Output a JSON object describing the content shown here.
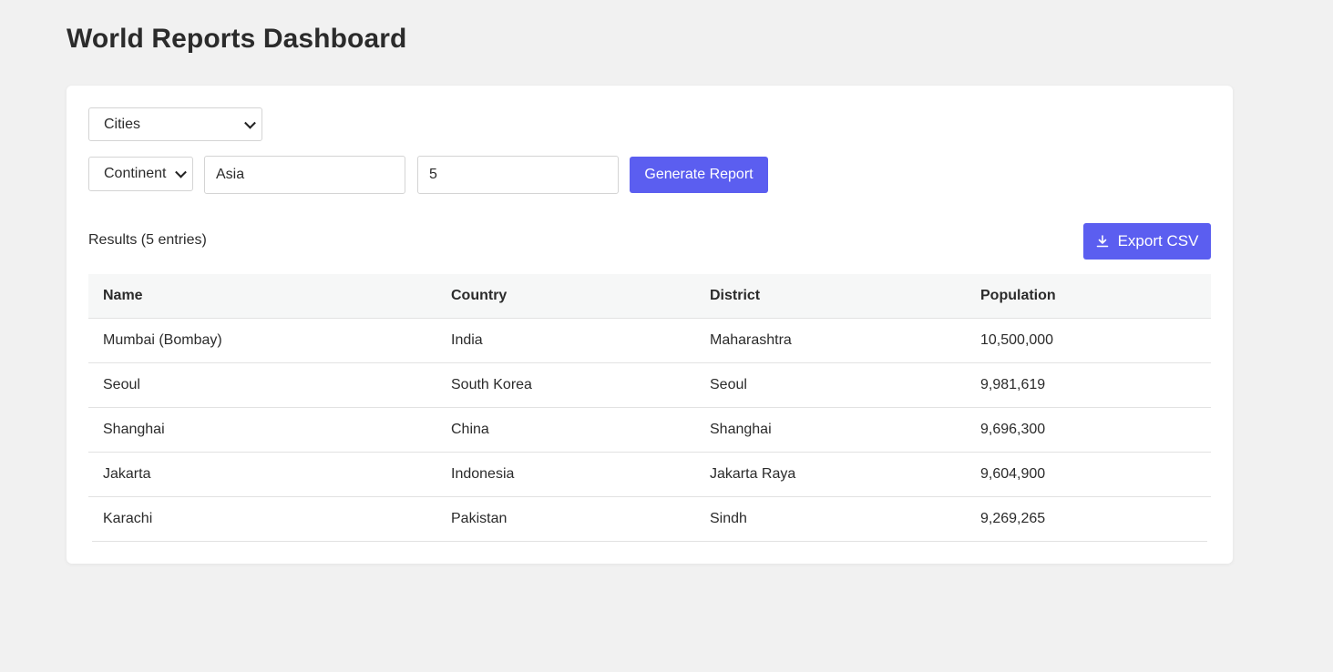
{
  "header": {
    "title": "World Reports Dashboard"
  },
  "controls": {
    "report_type": "Cities",
    "filter_type": "Continent",
    "filter_value": "Asia",
    "limit_value": "5",
    "generate_label": "Generate Report"
  },
  "results": {
    "label": "Results (5 entries)",
    "export_label": "Export CSV",
    "columns": [
      "Name",
      "Country",
      "District",
      "Population"
    ],
    "rows": [
      {
        "name": "Mumbai (Bombay)",
        "country": "India",
        "district": "Maharashtra",
        "population": "10,500,000"
      },
      {
        "name": "Seoul",
        "country": "South Korea",
        "district": "Seoul",
        "population": "9,981,619"
      },
      {
        "name": "Shanghai",
        "country": "China",
        "district": "Shanghai",
        "population": "9,696,300"
      },
      {
        "name": "Jakarta",
        "country": "Indonesia",
        "district": "Jakarta Raya",
        "population": "9,604,900"
      },
      {
        "name": "Karachi",
        "country": "Pakistan",
        "district": "Sindh",
        "population": "9,269,265"
      }
    ]
  },
  "icons": {
    "export": "download-icon",
    "select": "chevron-down-icon"
  },
  "colors": {
    "accent": "#5b5ef0",
    "background": "#f1f1f1",
    "card": "#ffffff",
    "table_header": "#f6f7f7"
  }
}
